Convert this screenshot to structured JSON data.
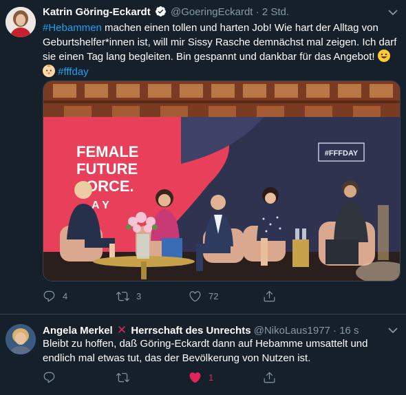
{
  "tweets": [
    {
      "author": {
        "name": "Katrin Göring-Eckardt",
        "handle": "@GoeringEckardt",
        "verified": true
      },
      "time": "2 Std.",
      "text_parts": {
        "hashtag1": "#Hebammen",
        "body": " machen einen tollen und harten Job! Wie hart der Alltag von Geburtshelfer*innen ist, will mir Sissy Rasche demnächst mal zeigen. Ich darf sie einen Tag lang begleiten. Bin gespannt und dankbar für das Angebot! ",
        "hashtag2": "#fffday"
      },
      "media": {
        "banner_line1": "FEMALE",
        "banner_line2": "FUTURE",
        "banner_line3": "ORCE.",
        "banner_line4": "A Y",
        "sign": "#FFFDAY"
      },
      "actions": {
        "replies": "4",
        "retweets": "3",
        "likes": "72",
        "liked": false
      }
    },
    {
      "author": {
        "name": "Angela Merkel",
        "name_suffix": "Herrschaft des Unrechts",
        "handle": "@NikoLaus1977"
      },
      "time": "16 s",
      "text": "Bleibt zu hoffen, daß Göring-Eckardt dann auf Hebamme umsattelt und endlich mal etwas tut, das der Bevölkerung von Nutzen ist.",
      "actions": {
        "replies": "",
        "retweets": "",
        "likes": "1",
        "liked": true
      }
    }
  ],
  "colors": {
    "background": "#15202b",
    "secondary_text": "#8899a6",
    "accent": "#1da1f2",
    "like": "#e0245e",
    "border": "#38444d"
  },
  "icons": [
    "verified-badge-icon",
    "chevron-down-icon",
    "reply-icon",
    "retweet-icon",
    "like-icon",
    "share-icon",
    "red-cross-mark-icon",
    "grinning-face-emoji",
    "baby-face-emoji"
  ]
}
